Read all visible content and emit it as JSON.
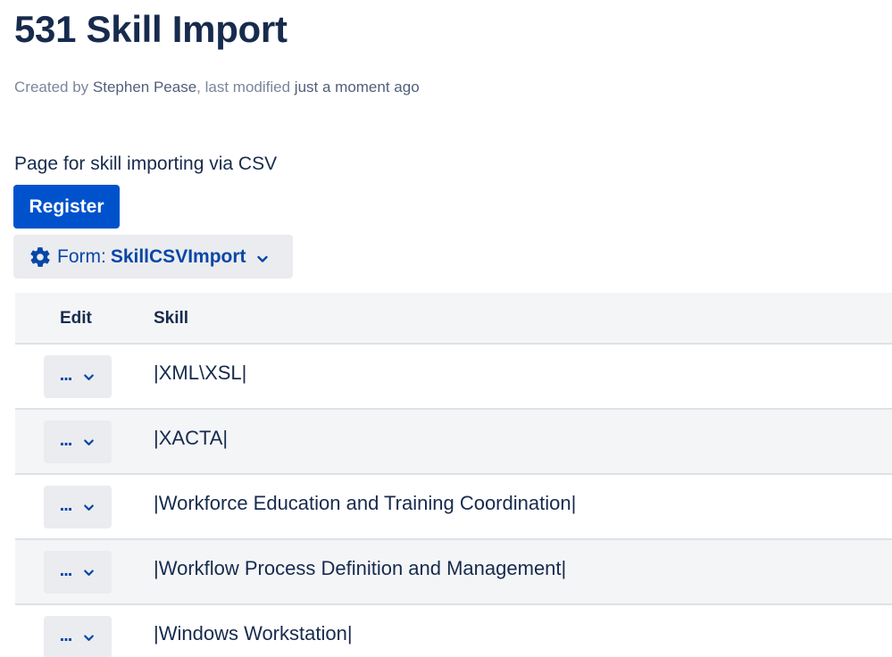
{
  "page": {
    "title": "531 Skill Import",
    "byline": {
      "created_by_label": "Created by",
      "author": "Stephen Pease",
      "modified_label": ", last modified",
      "modified_when": "just a moment ago"
    },
    "intro": "Page for skill importing via CSV"
  },
  "actions": {
    "register_label": "Register",
    "form_prefix": "Form:",
    "form_name": "SkillCSVImport"
  },
  "table": {
    "headers": [
      "Edit",
      "Skill"
    ],
    "edit_button_label": "...",
    "rows": [
      {
        "skill": "|XML\\XSL|"
      },
      {
        "skill": "|XACTA|"
      },
      {
        "skill": "|Workforce Education and Training Coordination|"
      },
      {
        "skill": "|Workflow Process Definition and Management|"
      },
      {
        "skill": "|Windows Workstation|"
      }
    ]
  },
  "colors": {
    "accent": "#0052cc",
    "link": "#0747a6",
    "text": "#172b4d",
    "muted": "#7a869a",
    "button_bg": "#ebecf0",
    "row_alt_bg": "#f4f5f7"
  },
  "icons": {
    "form_icon": "gear-icon",
    "dropdown_icon": "chevron-down-icon"
  }
}
